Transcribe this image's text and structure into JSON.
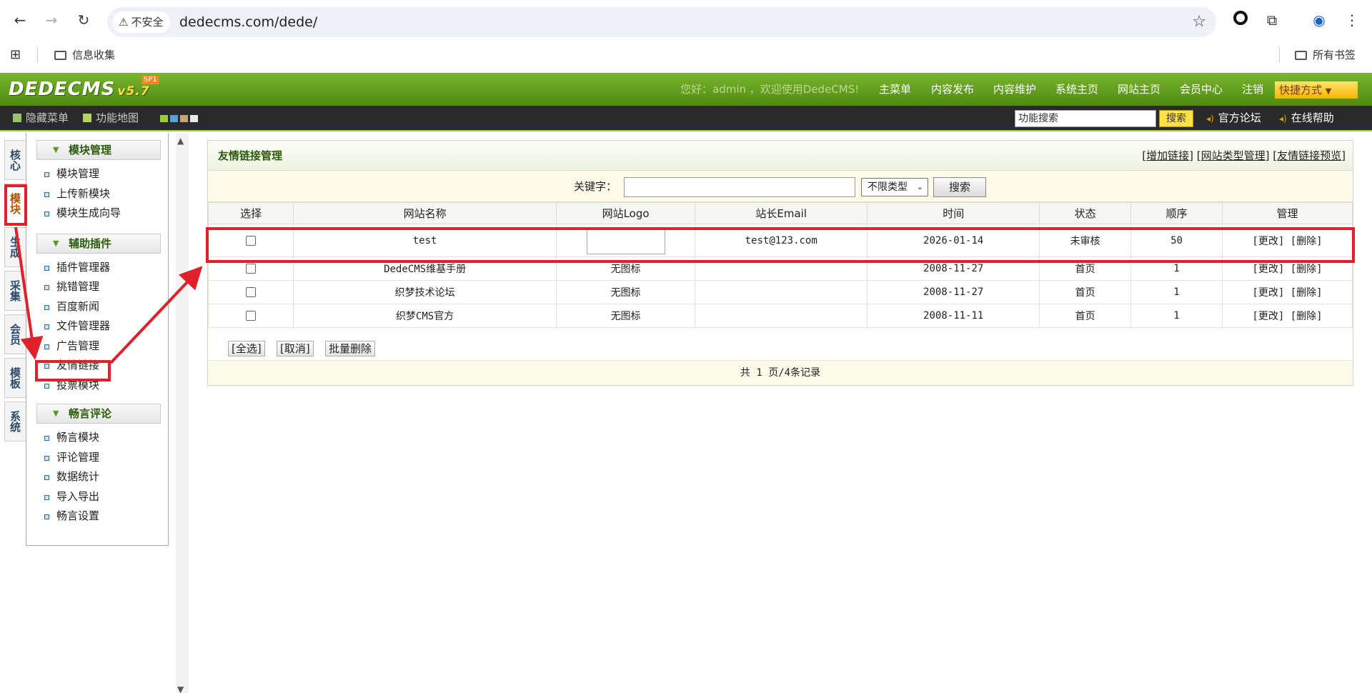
{
  "browser": {
    "security_label": "不安全",
    "url": "dedecms.com/dede/",
    "bookmarks": [
      {
        "label": "信息收集"
      }
    ],
    "all_bookmarks": "所有书签"
  },
  "header": {
    "logo": "DEDECMS",
    "version": "v5.7",
    "badge": "SP1",
    "greeting": "您好：admin ，欢迎使用DedeCMS!",
    "nav": [
      "主菜单",
      "内容发布",
      "内容维护",
      "系统主页",
      "网站主页",
      "会员中心",
      "注销"
    ],
    "quick": "快捷方式",
    "quick_add": "+"
  },
  "toolbar": {
    "hide_menu": "隐藏菜单",
    "func_map": "功能地图",
    "search_value": "功能搜索",
    "search_btn": "搜索",
    "forum": "官方论坛",
    "help": "在线帮助"
  },
  "vtabs": [
    {
      "label": "核心"
    },
    {
      "label": "模块"
    },
    {
      "label": "生成"
    },
    {
      "label": "采集"
    },
    {
      "label": "会员"
    },
    {
      "label": "模板"
    },
    {
      "label": "系统"
    }
  ],
  "menu": {
    "sections": [
      {
        "title": "模块管理",
        "items": [
          "模块管理",
          "上传新模块",
          "模块生成向导"
        ]
      },
      {
        "title": "辅助插件",
        "items": [
          "插件管理器",
          "挑错管理",
          "百度新闻",
          "文件管理器",
          "广告管理",
          "友情链接",
          "投票模块"
        ]
      },
      {
        "title": "畅言评论",
        "items": [
          "畅言模块",
          "评论管理",
          "数据统计",
          "导入导出",
          "畅言设置"
        ]
      }
    ]
  },
  "panel": {
    "title": "友情链接管理",
    "links": [
      "增加链接",
      "网站类型管理",
      "友情链接预览"
    ],
    "keyword_label": "关键字：",
    "type_select": "不限类型",
    "search_btn": "搜索",
    "columns": [
      "选择",
      "网站名称",
      "网站Logo",
      "站长Email",
      "时间",
      "状态",
      "顺序",
      "管理"
    ],
    "rows": [
      {
        "name": "test",
        "logo": "",
        "email": "test@123.com",
        "date": "2026-01-14",
        "status": "未审核",
        "order": "50",
        "edit": "[更改]",
        "delete": "[删除]"
      },
      {
        "name": "DedeCMS维基手册",
        "logo": "无图标",
        "email": "",
        "date": "2008-11-27",
        "status": "首页",
        "order": "1",
        "edit": "[更改]",
        "delete": "[删除]"
      },
      {
        "name": "织梦技术论坛",
        "logo": "无图标",
        "email": "",
        "date": "2008-11-27",
        "status": "首页",
        "order": "1",
        "edit": "[更改]",
        "delete": "[删除]"
      },
      {
        "name": "织梦CMS官方",
        "logo": "无图标",
        "email": "",
        "date": "2008-11-11",
        "status": "首页",
        "order": "1",
        "edit": "[更改]",
        "delete": "[删除]"
      }
    ],
    "select_all": "[全选]",
    "cancel": "[取消]",
    "batch_delete": "批量删除",
    "pager": "共 1 页/4条记录"
  },
  "colors": {
    "header_green": "#5f9a1c",
    "annotation_red": "#e0202a"
  }
}
